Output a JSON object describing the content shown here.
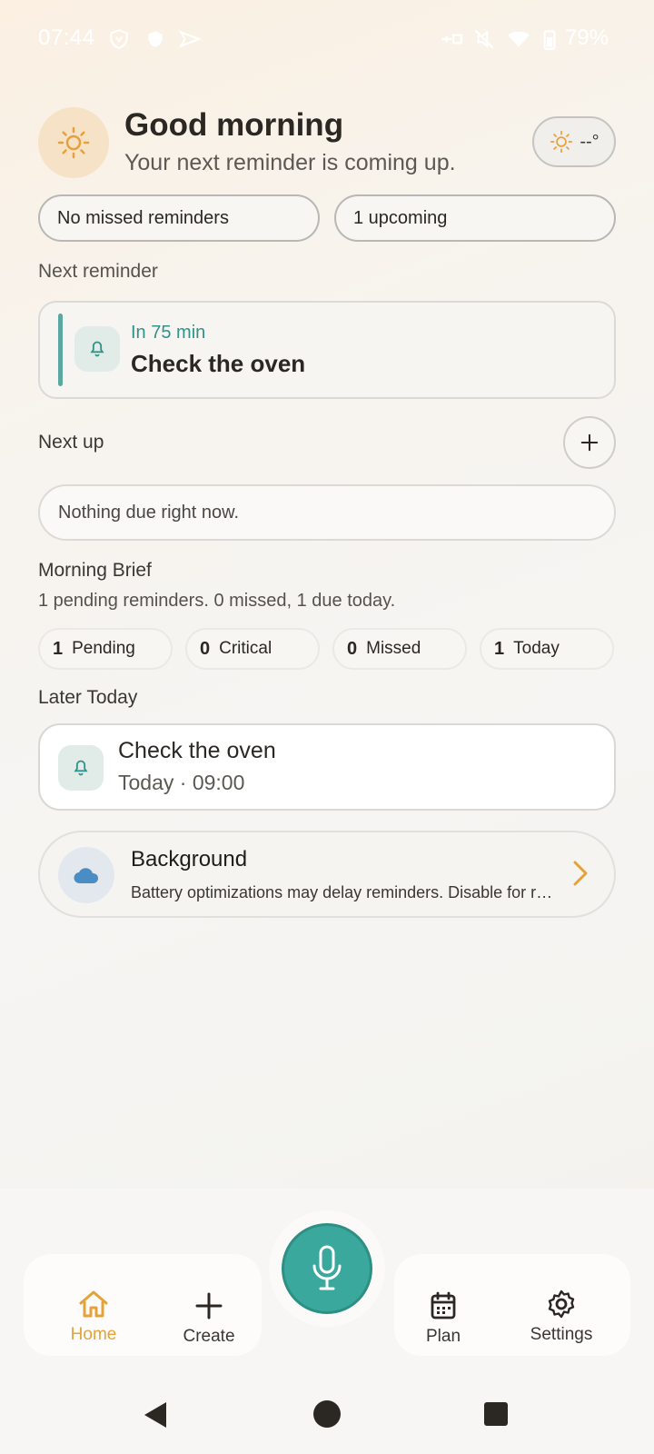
{
  "status_bar": {
    "time": "07:44",
    "battery": "79%"
  },
  "header": {
    "greeting": "Good morning",
    "subtitle": "Your next reminder is coming up.",
    "weather_temp": "--°"
  },
  "pills": {
    "missed": "No missed reminders",
    "upcoming": "1 upcoming"
  },
  "next_reminder": {
    "section_label": "Next reminder",
    "time": "In 75 min",
    "title": "Check the oven"
  },
  "next_up": {
    "section_label": "Next up",
    "empty_text": "Nothing due right now."
  },
  "morning_brief": {
    "title": "Morning Brief",
    "summary": "1 pending reminders. 0 missed, 1 due today.",
    "stats": [
      {
        "count": "1",
        "label": "Pending"
      },
      {
        "count": "0",
        "label": "Critical"
      },
      {
        "count": "0",
        "label": "Missed"
      },
      {
        "count": "1",
        "label": "Today"
      }
    ]
  },
  "later_today": {
    "section_label": "Later Today",
    "title": "Check the oven",
    "time": "Today · 09:00"
  },
  "background_card": {
    "title": "Background",
    "description": "Battery optimizations may delay reminders. Disable for reliable alerts."
  },
  "bottom_nav": {
    "home": "Home",
    "create": "Create",
    "plan": "Plan",
    "settings": "Settings"
  },
  "colors": {
    "accent_teal": "#3aa89c",
    "accent_orange": "#e3a33a",
    "sun": "#e8a03c"
  }
}
